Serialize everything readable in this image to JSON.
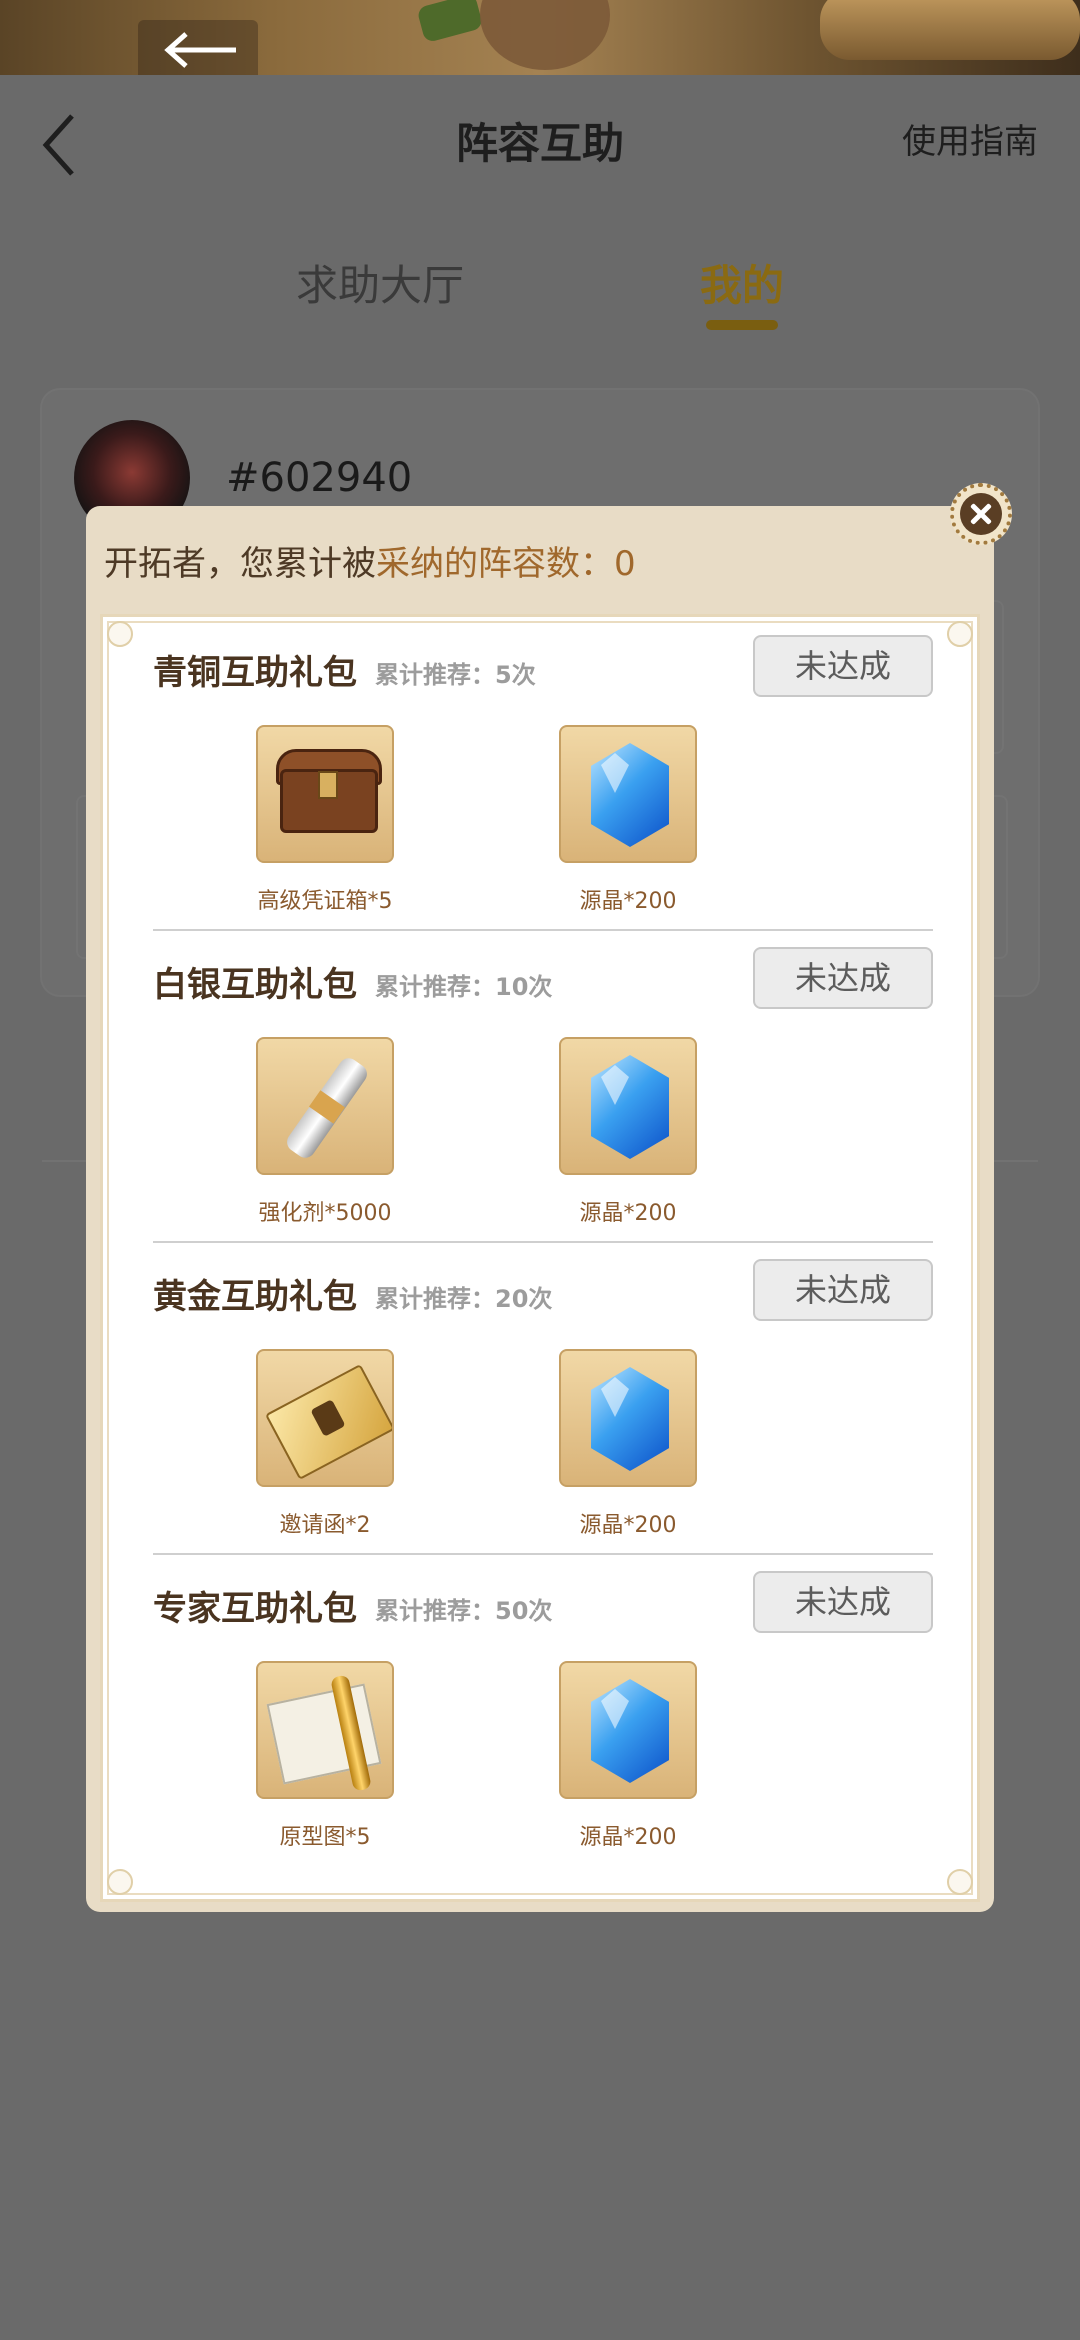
{
  "header": {
    "title": "阵容互助",
    "guide_label": "使用指南"
  },
  "tabs": [
    {
      "label": "求助大厅",
      "active": false
    },
    {
      "label": "我的",
      "active": true
    }
  ],
  "profile": {
    "user_id": "#602940"
  },
  "modal": {
    "header_prefix": "开拓者，您累计被",
    "header_highlight": "采纳的阵容数：0",
    "packs": [
      {
        "title": "青铜互助礼包",
        "count": "累计推荐：5次",
        "status": "未达成",
        "items": [
          {
            "icon": "chest-icon",
            "label": "高级凭证箱*5"
          },
          {
            "icon": "crystal-icon",
            "label": "源晶*200"
          }
        ]
      },
      {
        "title": "白银互助礼包",
        "count": "累计推荐：10次",
        "status": "未达成",
        "items": [
          {
            "icon": "vial-icon",
            "label": "强化剂*5000"
          },
          {
            "icon": "crystal-icon",
            "label": "源晶*200"
          }
        ]
      },
      {
        "title": "黄金互助礼包",
        "count": "累计推荐：20次",
        "status": "未达成",
        "items": [
          {
            "icon": "ticket-icon",
            "label": "邀请函*2"
          },
          {
            "icon": "crystal-icon",
            "label": "源晶*200"
          }
        ]
      },
      {
        "title": "专家互助礼包",
        "count": "累计推荐：50次",
        "status": "未达成",
        "items": [
          {
            "icon": "scroll-icon",
            "label": "原型图*5"
          },
          {
            "icon": "crystal-icon",
            "label": "源晶*200"
          }
        ]
      }
    ]
  },
  "colors": {
    "accent_gold": "#8a6a12",
    "highlight_text": "#a0682c",
    "modal_bg": "#e8dcc6",
    "overlay": "#6a6a6a"
  }
}
